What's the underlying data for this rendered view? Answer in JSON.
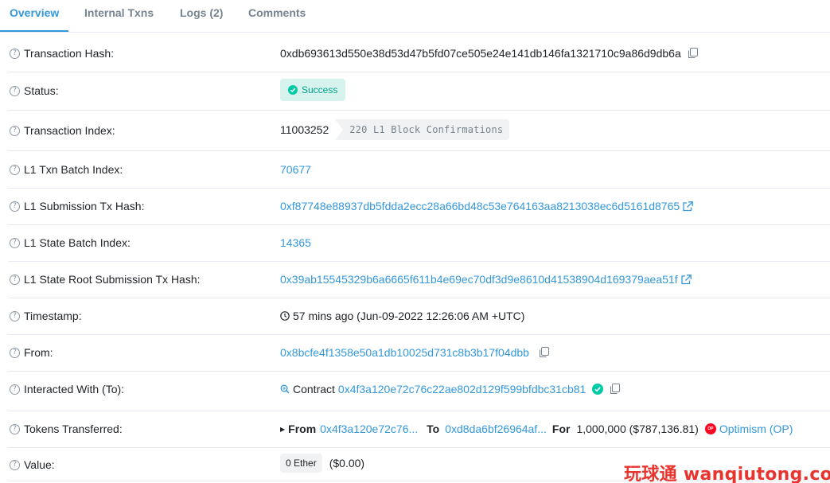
{
  "tabs": [
    {
      "label": "Overview"
    },
    {
      "label": "Internal Txns"
    },
    {
      "label": "Logs (2)"
    },
    {
      "label": "Comments"
    }
  ],
  "rows": {
    "tx_hash": {
      "label": "Transaction Hash:",
      "value": "0xdb693613d550e38d53d47b5fd07ce505e24e141db146fa1321710c9a86d9db6a"
    },
    "status": {
      "label": "Status:",
      "value": "Success"
    },
    "tx_index": {
      "label": "Transaction Index:",
      "value": "11003252",
      "confirmations": "220 L1 Block Confirmations"
    },
    "l1_batch": {
      "label": "L1 Txn Batch Index:",
      "value": "70677"
    },
    "l1_submission": {
      "label": "L1 Submission Tx Hash:",
      "value": "0xf87748e88937db5fdda2ecc28a66bd48c53e764163aa8213038ec6d5161d8765"
    },
    "l1_state_batch": {
      "label": "L1 State Batch Index:",
      "value": "14365"
    },
    "l1_state_root": {
      "label": "L1 State Root Submission Tx Hash:",
      "value": "0x39ab15545329b6a6665f611b4e69ec70df3d9e8610d41538904d169379aea51f"
    },
    "timestamp": {
      "label": "Timestamp:",
      "value": "57 mins ago (Jun-09-2022 12:26:06 AM +UTC)"
    },
    "from": {
      "label": "From:",
      "value": "0x8bcfe4f1358e50a1db10025d731c8b3b17f04dbb"
    },
    "interacted": {
      "label": "Interacted With (To):",
      "prefix": "Contract",
      "value": "0x4f3a120e72c76c22ae802d129f599bfdbc31cb81"
    },
    "tokens": {
      "label": "Tokens Transferred:",
      "from_label": "From",
      "from_value": "0x4f3a120e72c76...",
      "to_label": "To",
      "to_value": "0xd8da6bf26964af...",
      "for_label": "For",
      "amount": "1,000,000 ($787,136.81)",
      "token_logo_text": "OP",
      "token_name": "Optimism (OP)"
    },
    "value": {
      "label": "Value:",
      "ether": "0 Ether",
      "usd": "($0.00)"
    }
  },
  "watermark": "玩球通 wanqiutong.com",
  "colors": {
    "link": "#3498db",
    "success_bg": "#d6f3ee",
    "success_fg": "#00a186",
    "op_red": "#ff0420",
    "watermark": "#e8342e"
  }
}
